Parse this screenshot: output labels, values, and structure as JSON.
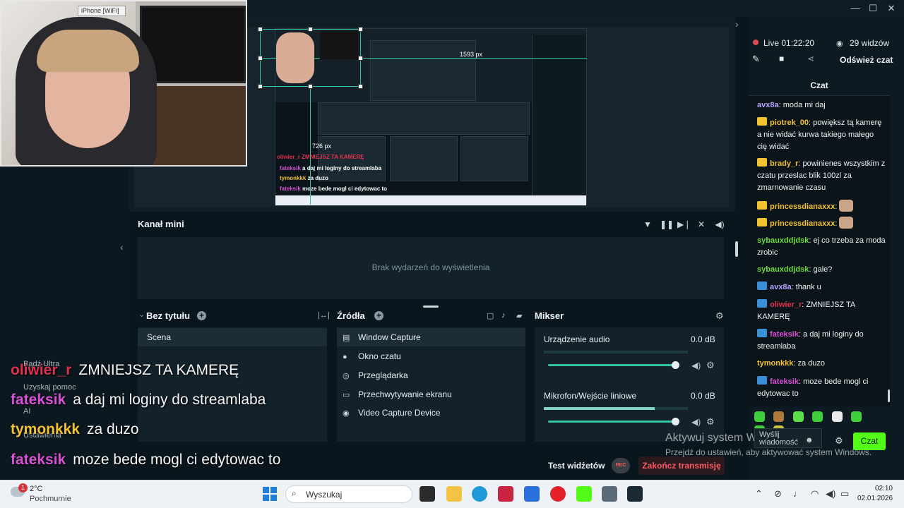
{
  "webcam": {
    "label": "iPhone [WiFi]"
  },
  "window_controls": {
    "minimize": "—",
    "maximize": "☐",
    "close": "✕"
  },
  "preview": {
    "width_label": "1593 px",
    "height_label": "726 px",
    "overlay_lines": [
      {
        "name": "oliwier_r",
        "msg": "ZMNIEJSZ TA KAMERĘ"
      },
      {
        "name": "fateksik",
        "msg": "a daj mi loginy do streamlaba"
      },
      {
        "name": "tymonkkk",
        "msg": "za duzo"
      },
      {
        "name": "fateksik",
        "msg": "moze bede mogl ci edytowac to"
      }
    ]
  },
  "kanal": {
    "title": "Kanał mini",
    "empty": "Brak wydarzeń do wyświetlenia"
  },
  "scenes": {
    "title": "Bez tytułu",
    "items": [
      "Scena"
    ]
  },
  "sources": {
    "title": "Źródła",
    "items": [
      "Window Capture",
      "Okno czatu",
      "Przeglądarka",
      "Przechwytywanie ekranu",
      "Video Capture Device"
    ]
  },
  "mixer": {
    "title": "Mikser",
    "channels": [
      {
        "name": "Urządzenie audio",
        "db": "0.0 dB"
      },
      {
        "name": "Mikrofon/Wejście liniowe",
        "db": "0.0 dB"
      }
    ]
  },
  "bottom": {
    "test": "Test widżetów",
    "rec": "REC",
    "end": "Zakończ transmisję"
  },
  "overlay_chat": [
    {
      "name": "oliwier_r",
      "msg": "ZMNIEJSZ TA KAMERĘ",
      "color": "#e23150"
    },
    {
      "name": "fateksik",
      "msg": "a daj mi loginy do streamlaba",
      "color": "#d94fd6"
    },
    {
      "name": "tymonkkk",
      "msg": "za duzo",
      "color": "#f2c230"
    },
    {
      "name": "fateksik",
      "msg": "moze bede mogl ci edytowac to",
      "color": "#d94fd6"
    }
  ],
  "left_menu": [
    "Bądź Ultra",
    "Uzyskaj pomoc",
    "AI",
    "Ustawienia"
  ],
  "stream": {
    "live": "Live 01:22:20",
    "viewers": "29 widzów",
    "refresh": "Odśwież czat"
  },
  "chat": {
    "title": "Czat",
    "messages": [
      {
        "name": "avx8a",
        "msg": "moda mi daj",
        "badge": "none",
        "color": "#b5a4ff"
      },
      {
        "name": "piotrek_00",
        "msg": "powiększ tą kamerę a nie widać kurwa takiego małego cię widać",
        "badge": "crown",
        "color": "#f2c230"
      },
      {
        "name": "brady_r",
        "msg": "powinienes wszystkim z czatu przeslac blik 100zl za zmarnowanie czasu",
        "badge": "crown",
        "color": "#f2c230"
      },
      {
        "name": "princessdianaxxx",
        "msg": "",
        "badge": "crown",
        "color": "#f2c230"
      },
      {
        "name": "princessdianaxxx",
        "msg": "",
        "badge": "crown",
        "color": "#f2c230"
      },
      {
        "name": "sybauxddjdsk",
        "msg": "ej co trzeba za moda zrobic",
        "badge": "none",
        "color": "#6bdb3c"
      },
      {
        "name": "sybauxddjdsk",
        "msg": "gale?",
        "badge": "none",
        "color": "#6bdb3c"
      },
      {
        "name": "avx8a",
        "msg": "thank u",
        "badge": "blue",
        "color": "#b5a4ff"
      },
      {
        "name": "oliwier_r",
        "msg": "ZMNIEJSZ TA KAMERĘ",
        "badge": "blue",
        "color": "#e23150"
      },
      {
        "name": "fateksik",
        "msg": "a daj mi loginy do streamlaba",
        "badge": "blue",
        "color": "#d94fd6"
      },
      {
        "name": "tymonkkk",
        "msg": "za duzo",
        "badge": "none",
        "color": "#f2c230"
      },
      {
        "name": "fateksik",
        "msg": "moze bede mogl ci edytowac to",
        "badge": "blue",
        "color": "#d94fd6"
      }
    ],
    "input_placeholder": "Wyślij wiadomość",
    "send": "Czat"
  },
  "activation": {
    "title": "Aktywuj system Windows",
    "subtitle": "Przejdź do ustawień, aby aktywować system Windows."
  },
  "taskbar": {
    "weather_temp": "2°C",
    "weather_desc": "Pochmurnie",
    "notif_count": "1",
    "search": "Wyszukaj",
    "time": "02:10",
    "date": "02.01.2026"
  }
}
